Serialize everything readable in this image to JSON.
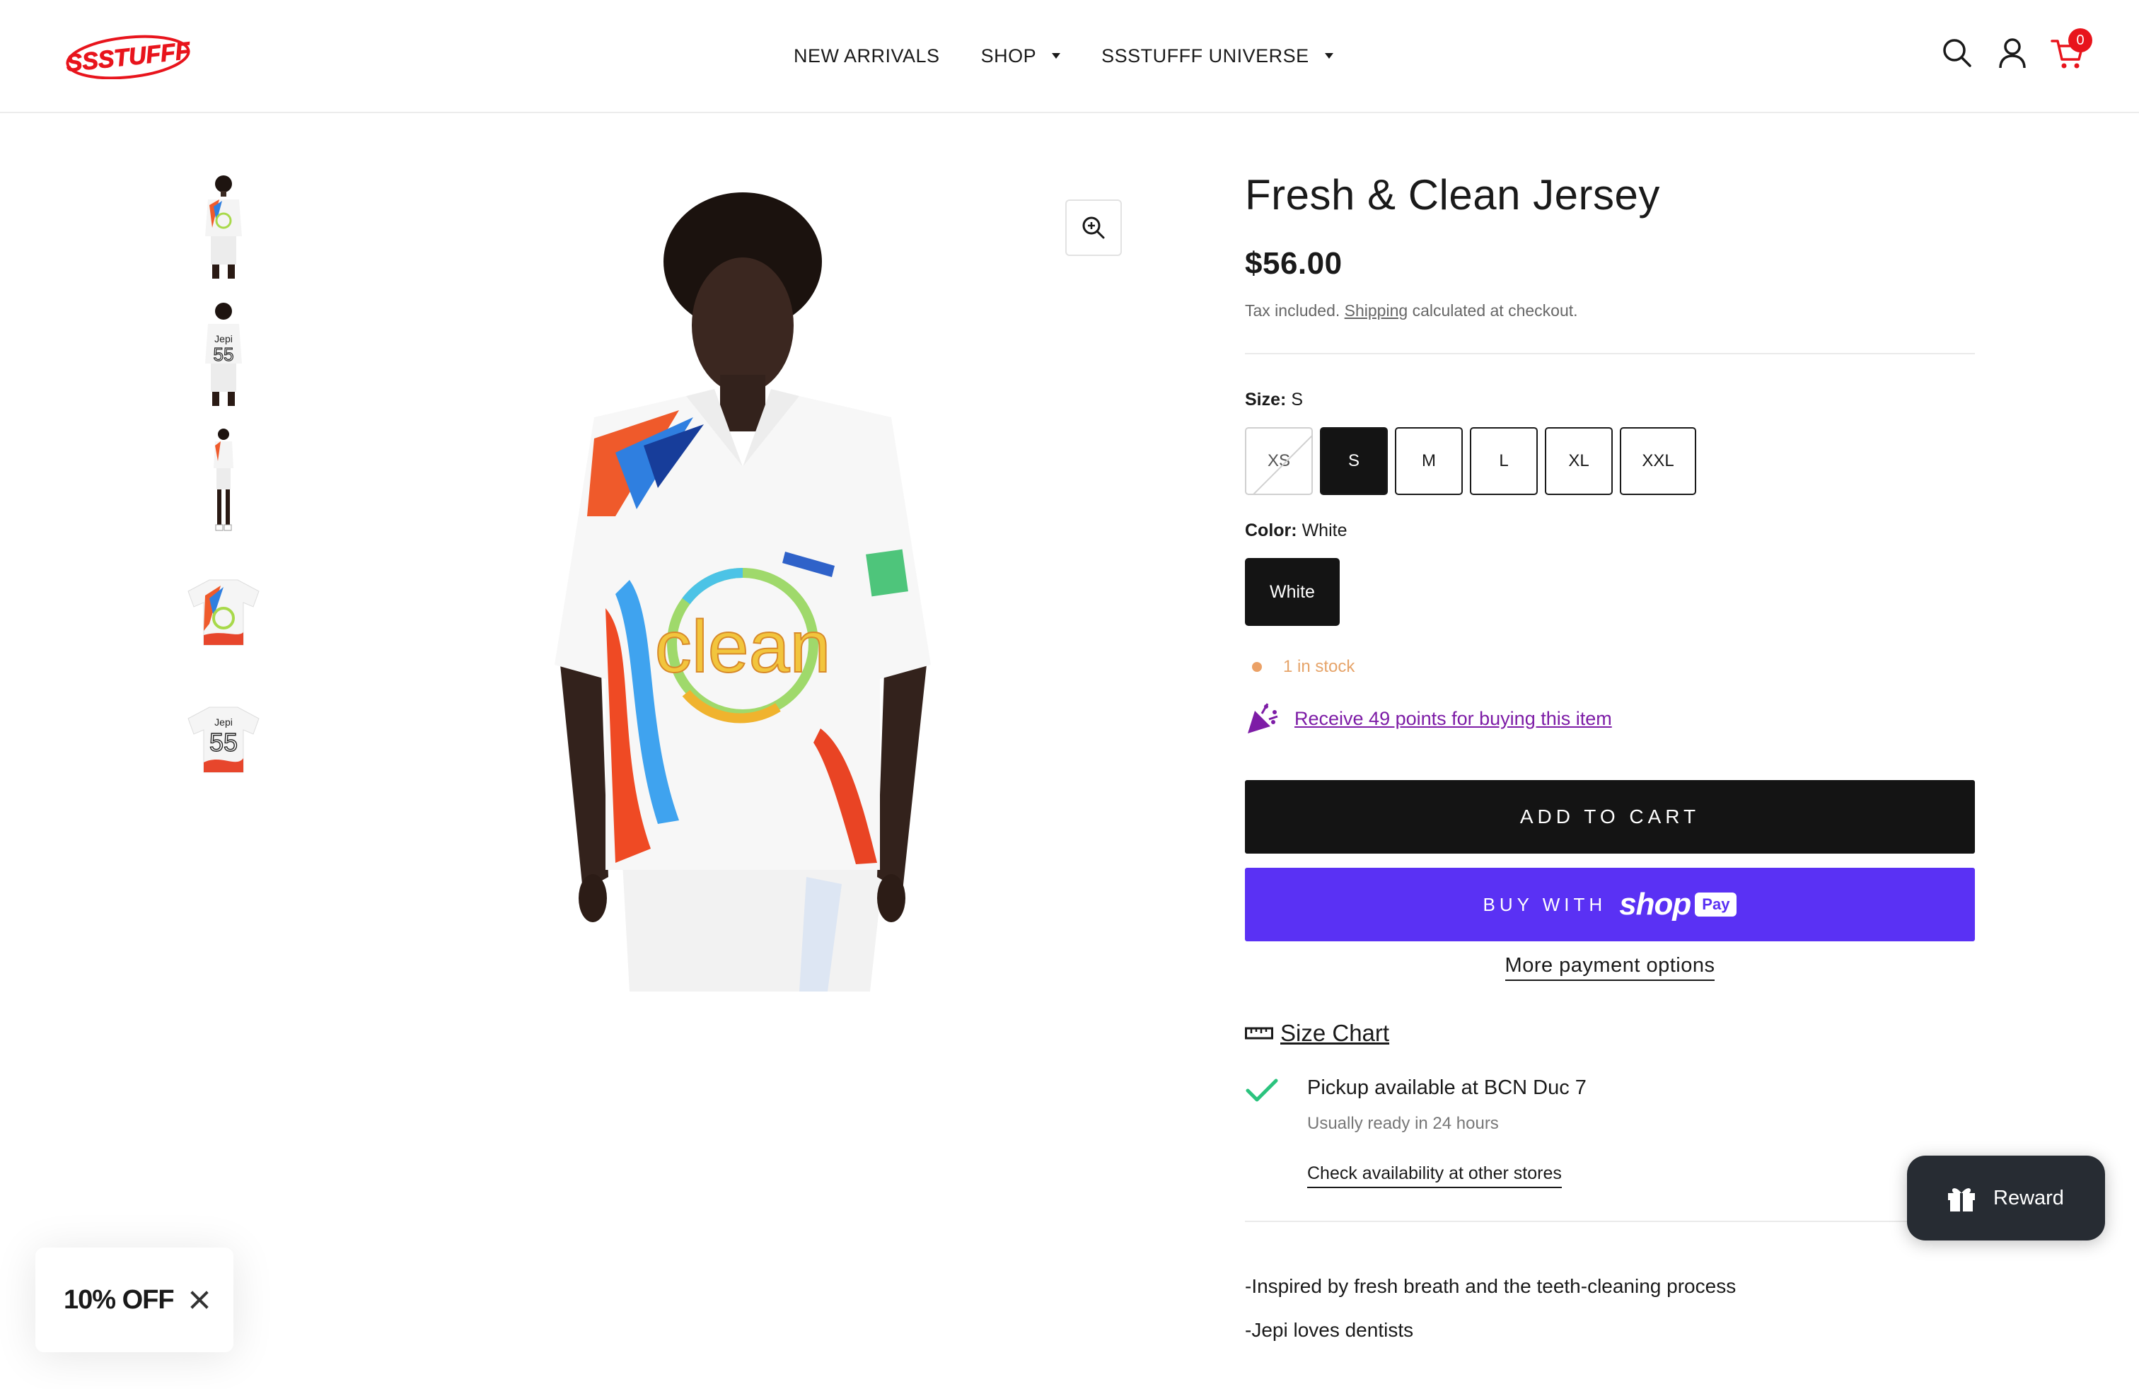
{
  "header": {
    "logo_text": "SSSTUFFF",
    "nav": [
      {
        "label": "NEW ARRIVALS",
        "dropdown": false
      },
      {
        "label": "SHOP",
        "dropdown": true
      },
      {
        "label": "SSSTUFFF UNIVERSE",
        "dropdown": true
      }
    ],
    "icons": [
      "search-icon",
      "account-icon",
      "cart-icon"
    ],
    "cart_count": "0"
  },
  "gallery": {
    "thumbnails": [
      "front-model",
      "back-model",
      "full-body-model",
      "flat-front",
      "flat-back"
    ],
    "main_image_text": "clean",
    "back_number": "55",
    "back_name": "Jepi"
  },
  "product": {
    "title": "Fresh & Clean Jersey",
    "price": "$56.00",
    "tax_prefix": "Tax included.",
    "shipping_link": "Shipping",
    "tax_suffix": "calculated at checkout.",
    "size_label": "Size:",
    "size_value": "S",
    "sizes": [
      {
        "label": "XS",
        "state": "sold-out"
      },
      {
        "label": "S",
        "state": "selected"
      },
      {
        "label": "M",
        "state": "available"
      },
      {
        "label": "L",
        "state": "available"
      },
      {
        "label": "XL",
        "state": "available"
      },
      {
        "label": "XXL",
        "state": "available"
      }
    ],
    "color_label": "Color:",
    "color_value": "White",
    "colors": [
      "White"
    ],
    "stock": "1 in stock",
    "points_text": "Receive 49 points for buying this item",
    "add_to_cart": "ADD TO CART",
    "buy_with": "BUY WITH",
    "shop_word": "shop",
    "pay_word": "Pay",
    "more_payment": "More payment options",
    "size_chart": "Size Chart",
    "pickup_main": "Pickup available at BCN Duc 7",
    "pickup_sub": "Usually ready in 24 hours",
    "check_availability": "Check availability at other stores",
    "description": [
      "-Inspired by fresh breath and the teeth-cleaning process",
      "-Jepi loves dentists"
    ]
  },
  "widgets": {
    "discount_text": "10% OFF",
    "reward_label": "Reward"
  },
  "colors": {
    "brand_red": "#e8141c",
    "shop_pay": "#5a31f4",
    "stock_orange": "#eba166",
    "points_purple": "#7d1ca6",
    "check_green": "#2bc37e",
    "reward_bg": "#272c33"
  }
}
